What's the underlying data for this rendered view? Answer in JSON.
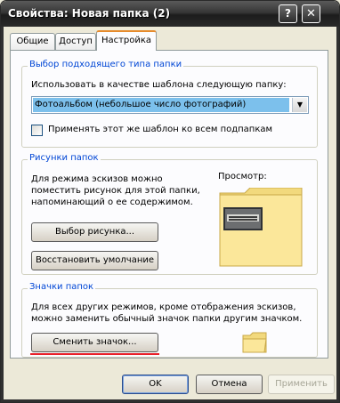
{
  "window": {
    "title": "Свойства: Новая папка (2)",
    "help_glyph": "?",
    "close_glyph": "✕"
  },
  "tabs": [
    {
      "label": "Общие"
    },
    {
      "label": "Доступ"
    },
    {
      "label": "Настройка"
    }
  ],
  "folder_type_group": {
    "legend": "Выбор подходящего типа папки",
    "template_label": "Использовать в качестве шаблона следующую папку:",
    "template_selected": "Фотоальбом (небольшое число фотографий)",
    "apply_all_label": "Применять этот же шаблон ко всем подпапкам",
    "apply_all_checked": false
  },
  "pictures_group": {
    "legend": "Рисунки папок",
    "description": "Для режима эскизов можно поместить рисунок для этой папки, напоминающий о ее содержимом.",
    "preview_label": "Просмотр:",
    "choose_button": "Выбор рисунка...",
    "restore_button": "Восстановить умолчание"
  },
  "icons_group": {
    "legend": "Значки папок",
    "description": "Для всех других режимов, кроме отображения эскизов, можно заменить обычный значок папки другим значком.",
    "change_button": "Сменить значок..."
  },
  "footer": {
    "ok": "OK",
    "cancel": "Отмена",
    "apply": "Применить"
  },
  "colors": {
    "titlebar": "#2a2a2a",
    "group_legend": "#0046d5",
    "selection": "#7cc0ec",
    "underline_mark": "#e8202a"
  }
}
